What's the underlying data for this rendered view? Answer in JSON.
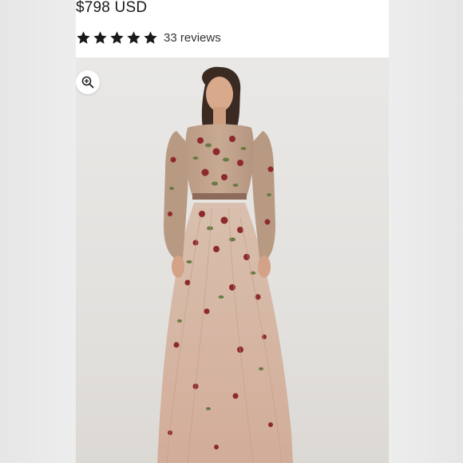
{
  "product": {
    "price": "$798 USD",
    "rating": {
      "stars": 5,
      "max_stars": 5,
      "reviews_text": "33 reviews"
    }
  },
  "gallery": {
    "zoom_icon": "zoom-in-icon",
    "image_subject": "woman-in-floral-embroidered-long-sleeve-gown"
  },
  "colors": {
    "star": "#1a1a1a",
    "gown_tulle": "#d7b9a6",
    "embroidery_red": "#8e2a2c",
    "embroidery_green": "#6b7a45"
  }
}
